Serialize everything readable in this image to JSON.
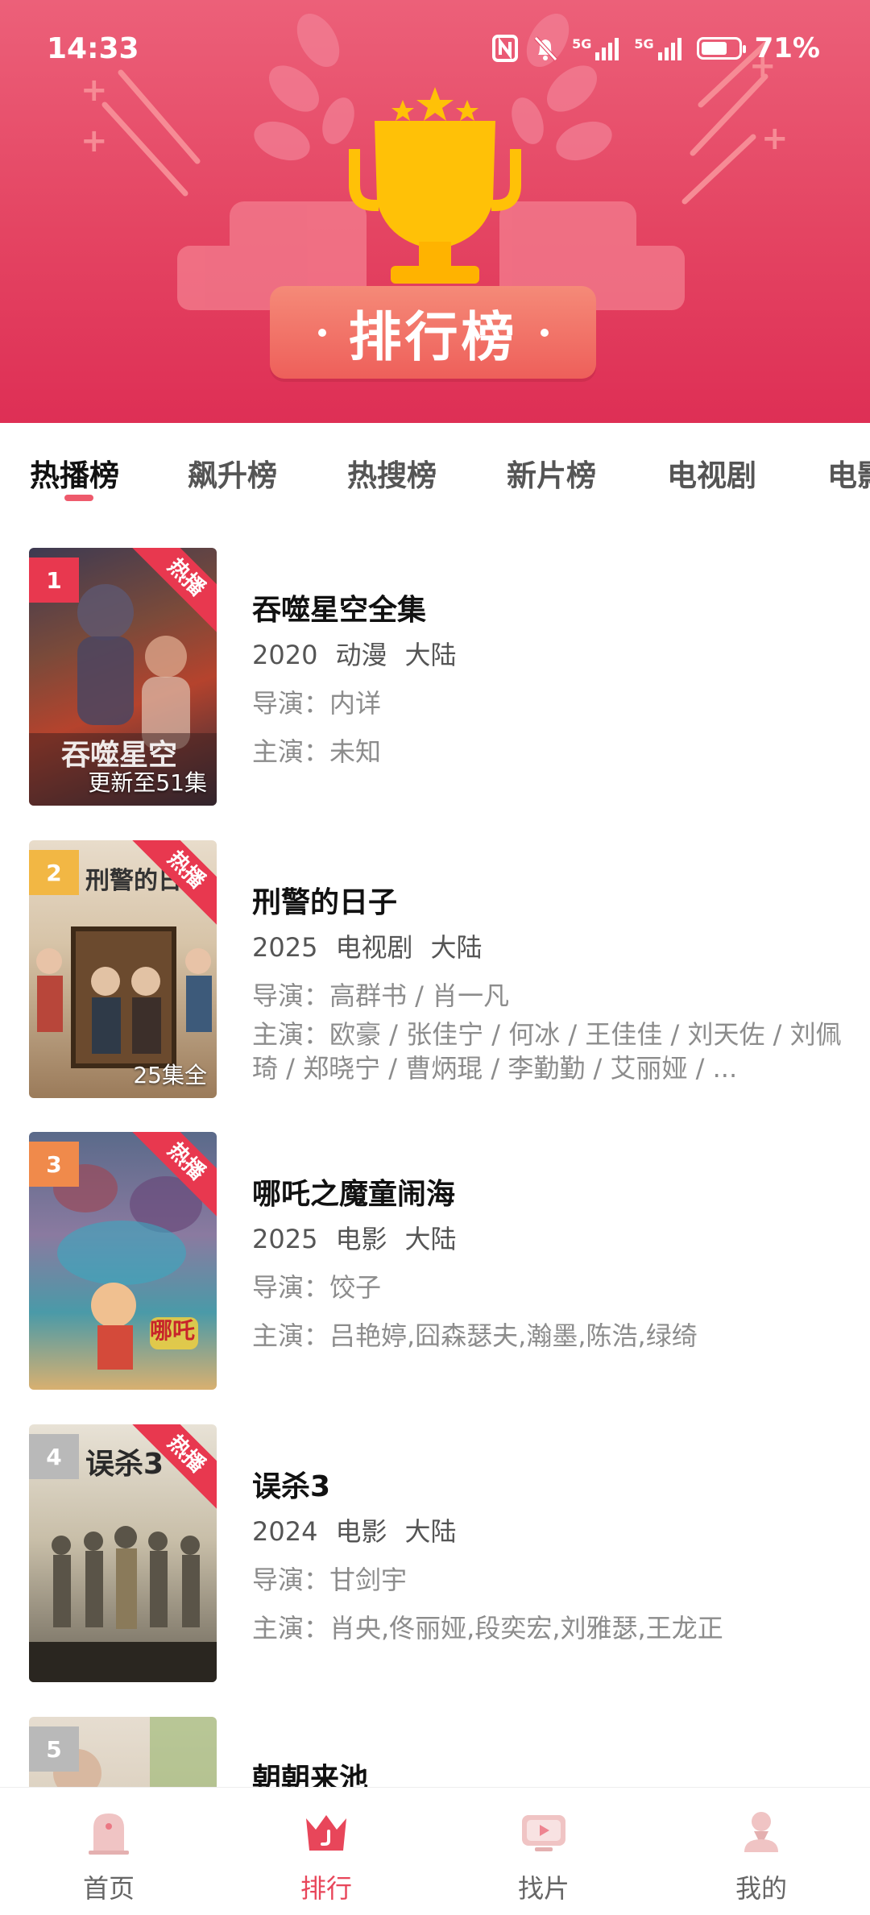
{
  "status_bar": {
    "time": "14:33",
    "signal1": "5G",
    "signal2": "5G",
    "battery": "71%",
    "battery_level": 0.71
  },
  "banner": {
    "title": "排行榜"
  },
  "tabs": [
    {
      "label": "热播榜",
      "active": true
    },
    {
      "label": "飙升榜",
      "active": false
    },
    {
      "label": "热搜榜",
      "active": false
    },
    {
      "label": "新片榜",
      "active": false
    },
    {
      "label": "电视剧",
      "active": false
    },
    {
      "label": "电影",
      "active": false
    }
  ],
  "items": [
    {
      "rank": "1",
      "badge": "热播",
      "caption": "更新至51集",
      "poster_text": "吞噬星空",
      "title": "吞噬星空全集",
      "year": "2020",
      "genre": "动漫",
      "region": "大陆",
      "director": "导演：内详",
      "cast": "主演：未知"
    },
    {
      "rank": "2",
      "badge": "热播",
      "caption": "25集全",
      "poster_text": "刑警的日子",
      "title": "刑警的日子",
      "year": "2025",
      "genre": "电视剧",
      "region": "大陆",
      "director": "导演：高群书 / 肖一凡",
      "cast": "主演：欧豪 / 张佳宁 / 何冰 / 王佳佳 / 刘天佐 / 刘佩琦 / 郑晓宁 / 曹炳琨 / 李勤勤 / 艾丽娅 / ..."
    },
    {
      "rank": "3",
      "badge": "热播",
      "caption": "",
      "poster_text": "哪吒",
      "title": "哪吒之魔童闹海",
      "year": "2025",
      "genre": "电影",
      "region": "大陆",
      "director": "导演：饺子",
      "cast": "主演：吕艳婷,囧森瑟夫,瀚墨,陈浩,绿绮"
    },
    {
      "rank": "4",
      "badge": "热播",
      "caption": "",
      "poster_text": "误杀3",
      "title": "误杀3",
      "year": "2024",
      "genre": "电影",
      "region": "大陆",
      "director": "导演：甘剑宇",
      "cast": "主演：肖央,佟丽娅,段奕宏,刘雅瑟,王龙正"
    },
    {
      "rank": "5",
      "title": "朝朝来池"
    }
  ],
  "bottom_nav": [
    {
      "label": "首页",
      "icon": "home-icon",
      "active": false
    },
    {
      "label": "排行",
      "icon": "crown-icon",
      "active": true
    },
    {
      "label": "找片",
      "icon": "tv-icon",
      "active": false
    },
    {
      "label": "我的",
      "icon": "user-icon",
      "active": false
    }
  ],
  "colors": {
    "accent": "#e8465a",
    "banner_top": "#ec6079",
    "banner_bottom": "#de2f55",
    "rank1": "#e8384f",
    "rank2": "#f2b744",
    "rank3": "#f08a4b",
    "rank_other": "#b9b9b9",
    "trophy": "#ffc107"
  }
}
